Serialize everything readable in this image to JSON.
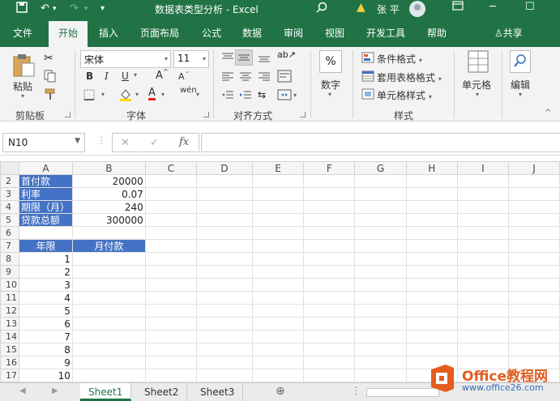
{
  "window": {
    "title": "数据表类型分析  -  Excel",
    "user": "张 平"
  },
  "tabs": [
    "文件",
    "开始",
    "插入",
    "页面布局",
    "公式",
    "数据",
    "审阅",
    "视图",
    "开发工具",
    "帮助"
  ],
  "share_label": "共享",
  "ribbon": {
    "clipboard": {
      "paste": "粘贴",
      "label": "剪贴板"
    },
    "font": {
      "name": "宋体",
      "size": "11",
      "label": "字体",
      "bold": "B",
      "italic": "I",
      "underline": "U",
      "grow": "A",
      "shrink": "A",
      "wen": "wén",
      "font_color": "A"
    },
    "alignment": {
      "label": "对齐方式"
    },
    "number": {
      "label": "数字",
      "symbol": "%"
    },
    "styles": {
      "conditional": "条件格式",
      "table": "套用表格格式",
      "cell": "单元格样式",
      "label": "样式"
    },
    "cells": {
      "label": "单元格"
    },
    "editing": {
      "label": "编辑"
    }
  },
  "formula_bar": {
    "name_box": "N10",
    "cancel": "✕",
    "enter": "✓",
    "fx": "fx",
    "value": ""
  },
  "columns": [
    "A",
    "B",
    "C",
    "D",
    "E",
    "F",
    "G",
    "H",
    "I",
    "J"
  ],
  "rows": [
    {
      "num": "2",
      "a": "首付款",
      "b": "20000"
    },
    {
      "num": "3",
      "a": "利率",
      "b": "0.07"
    },
    {
      "num": "4",
      "a": "期限（月）",
      "b": "240"
    },
    {
      "num": "5",
      "a": "贷款总额",
      "b": "300000"
    },
    {
      "num": "6",
      "a": "",
      "b": ""
    },
    {
      "num": "7",
      "a": "年限",
      "b": "月付款"
    },
    {
      "num": "8",
      "a": "1",
      "b": ""
    },
    {
      "num": "9",
      "a": "2",
      "b": ""
    },
    {
      "num": "10",
      "a": "3",
      "b": ""
    },
    {
      "num": "11",
      "a": "4",
      "b": ""
    },
    {
      "num": "12",
      "a": "5",
      "b": ""
    },
    {
      "num": "13",
      "a": "6",
      "b": ""
    },
    {
      "num": "14",
      "a": "7",
      "b": ""
    },
    {
      "num": "15",
      "a": "8",
      "b": ""
    },
    {
      "num": "16",
      "a": "9",
      "b": ""
    },
    {
      "num": "17",
      "a": "10",
      "b": ""
    }
  ],
  "sheets": [
    "Sheet1",
    "Sheet2",
    "Sheet3"
  ],
  "watermark": {
    "brand": "Office教程网",
    "url": "www.office26.com"
  },
  "colors": {
    "accent": "#217346",
    "cell_fill": "#4472c4"
  }
}
